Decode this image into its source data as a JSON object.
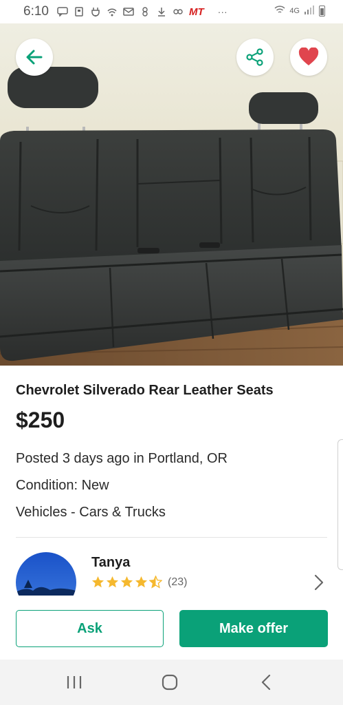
{
  "status_bar": {
    "time": "6:10",
    "carrier_badge": "MT",
    "network": "4G"
  },
  "listing": {
    "title": "Chevrolet Silverado Rear Leather Seats",
    "price": "$250",
    "posted": "Posted 3 days ago in Portland, OR",
    "condition": "Condition: New",
    "category": "Vehicles - Cars & Trucks"
  },
  "seller": {
    "name": "Tanya",
    "rating": 4.5,
    "rating_count": "(23)"
  },
  "actions": {
    "ask_label": "Ask",
    "offer_label": "Make offer"
  },
  "colors": {
    "accent": "#0aa178",
    "heart": "#e0454e",
    "star": "#f5b82e"
  }
}
